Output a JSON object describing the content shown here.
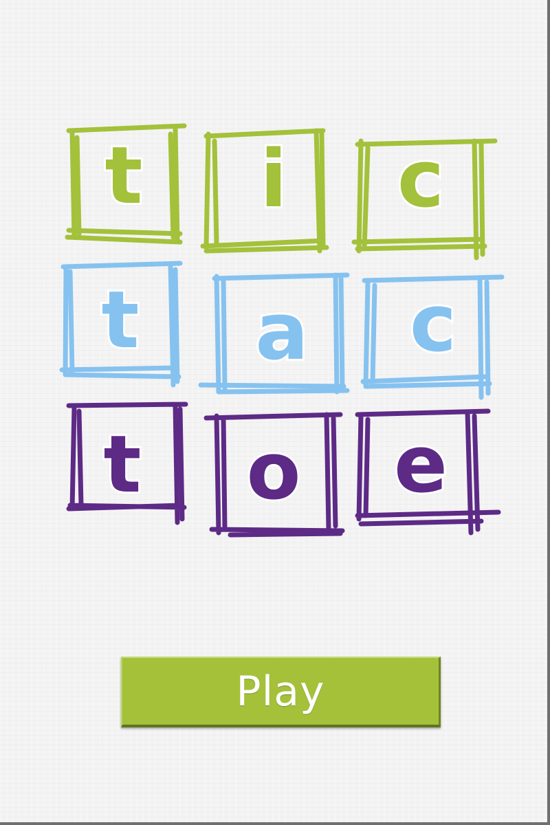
{
  "logo": {
    "rows": [
      {
        "color": "#a3c13a",
        "letters": [
          "t",
          "i",
          "c"
        ]
      },
      {
        "color": "#86c2ef",
        "letters": [
          "t",
          "a",
          "c"
        ]
      },
      {
        "color": "#5d2a86",
        "letters": [
          "t",
          "o",
          "e"
        ]
      }
    ]
  },
  "play_button": {
    "label": "Play",
    "color": "#a5c13a"
  }
}
